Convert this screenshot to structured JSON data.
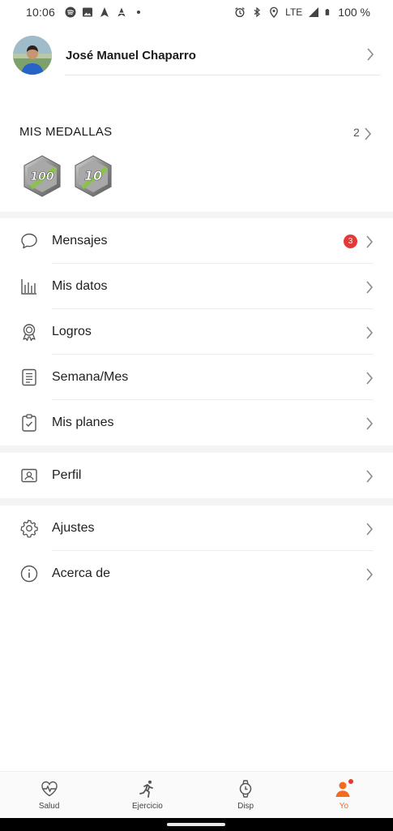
{
  "status_bar": {
    "time": "10:06",
    "network": "LTE",
    "battery": "100 %",
    "left_icons": [
      "spotify-icon",
      "image-icon",
      "navigation-icon",
      "navigation-outline-icon",
      "dot-icon"
    ],
    "right_icons": [
      "alarm-icon",
      "bluetooth-icon",
      "location-icon",
      "signal-icon",
      "battery-icon"
    ]
  },
  "profile": {
    "name": "José Manuel Chaparro"
  },
  "medals": {
    "title": "MIS MEDALLAS",
    "count": "2",
    "items": [
      {
        "label": "100"
      },
      {
        "label": "10"
      }
    ],
    "colors": {
      "accent": "#8bc34a",
      "metal": "#9e9e9e"
    }
  },
  "menu": {
    "group1": [
      {
        "label": "Mensajes",
        "icon": "message-icon",
        "badge": "3"
      },
      {
        "label": "Mis datos",
        "icon": "bar-chart-icon"
      },
      {
        "label": "Logros",
        "icon": "award-icon"
      },
      {
        "label": "Semana/Mes",
        "icon": "report-icon"
      },
      {
        "label": "Mis planes",
        "icon": "clipboard-check-icon"
      }
    ],
    "group2": [
      {
        "label": "Perfil",
        "icon": "profile-card-icon"
      }
    ],
    "group3": [
      {
        "label": "Ajustes",
        "icon": "gear-icon"
      },
      {
        "label": "Acerca de",
        "icon": "info-icon"
      }
    ]
  },
  "bottom_nav": {
    "items": [
      {
        "label": "Salud",
        "icon": "heart-pulse-icon"
      },
      {
        "label": "Ejercicio",
        "icon": "running-icon"
      },
      {
        "label": "Disp",
        "icon": "watch-icon"
      },
      {
        "label": "Yo",
        "icon": "person-icon",
        "active": true
      }
    ],
    "accent_color": "#f26b21",
    "notification_color": "#e53935"
  }
}
